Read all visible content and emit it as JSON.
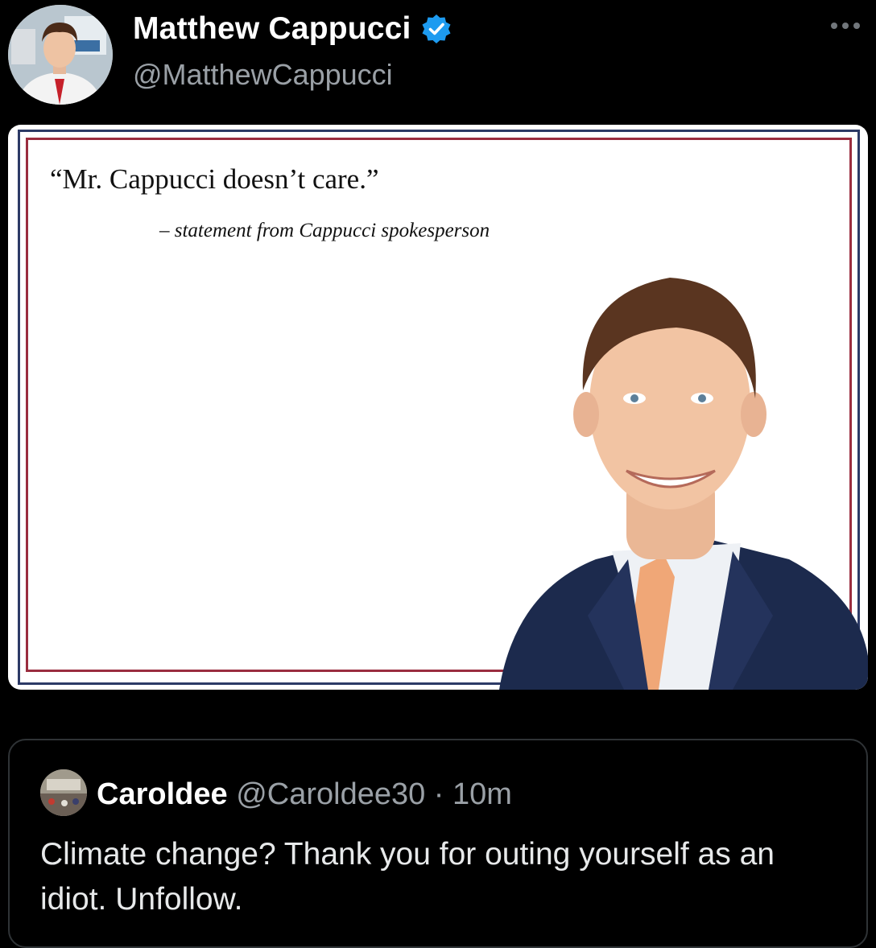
{
  "author": {
    "name": "Matthew Cappucci",
    "handle": "@MatthewCappucci",
    "verified": true,
    "avatar_icon": "profile-photo-avatar",
    "verified_icon": "verified-badge-icon",
    "verified_color": "#1d9bf0"
  },
  "menu_icon": "more-options-icon",
  "card": {
    "quote": "“Mr. Cappucci doesn’t care.”",
    "attribution": "– statement from Cappucci spokesperson",
    "border_blue": "#2c3a66",
    "border_red": "#9a2d3f"
  },
  "quoted_tweet": {
    "name": "Caroldee",
    "handle": "@Caroldee30",
    "separator": " · ",
    "time": "10m",
    "text": "Climate change?  Thank you for outing yourself as an idiot. Unfollow."
  },
  "colors": {
    "background": "#000000",
    "text": "#e7e9ea",
    "muted": "#9aa0a6",
    "border": "#2f3336"
  }
}
